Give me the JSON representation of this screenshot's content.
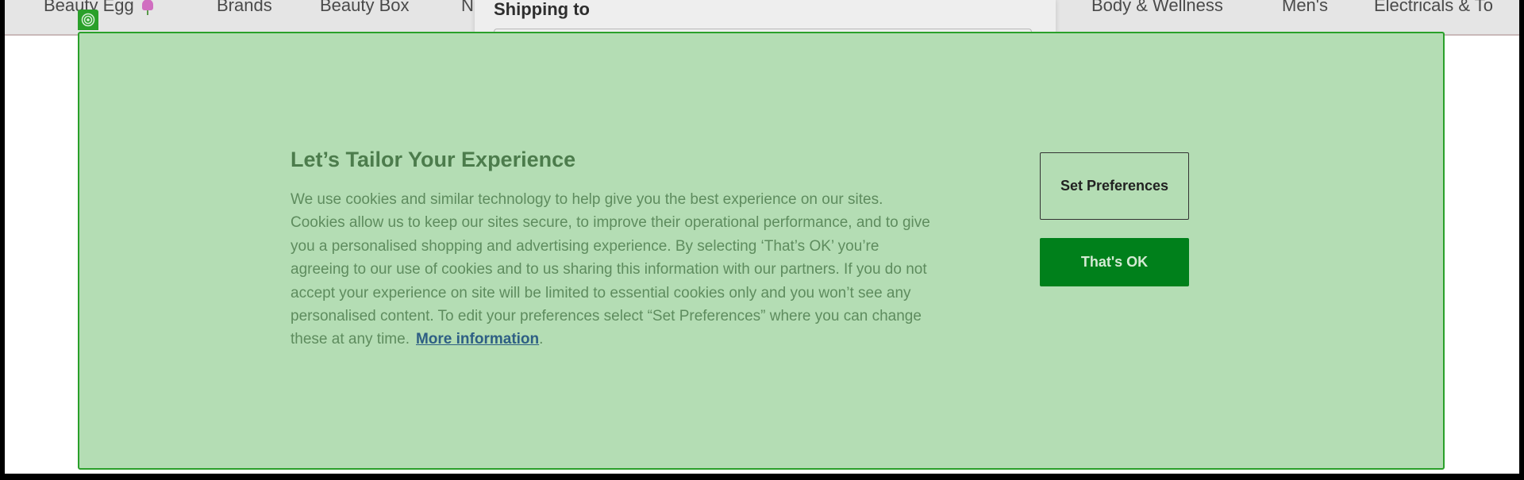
{
  "nav": {
    "items": [
      {
        "label": "Beauty Egg",
        "icon": "egg-flower-icon"
      },
      {
        "label": "Brands"
      },
      {
        "label": "Beauty Box"
      },
      {
        "label": "N"
      },
      {
        "label": "Body & Wellness"
      },
      {
        "label": "Men's"
      },
      {
        "label": "Electricals & To"
      }
    ]
  },
  "shipping": {
    "title": "Shipping to"
  },
  "cookie_banner": {
    "title": "Let’s Tailor Your Experience",
    "body": "We use cookies and similar technology to help give you the best experience on our sites. Cookies allow us to keep our sites secure, to improve their operational performance, and to give you a personalised shopping and advertising experience. By selecting ‘That’s OK’ you’re agreeing to our use of cookies and to us sharing this information with our partners. If you do not accept your experience on site will be limited to essential cookies only and you won’t see any personalised content. To edit your preferences select “Set Preferences” where you can change these at any time.",
    "link_text": "More information",
    "link_suffix": ".",
    "set_preferences_label": "Set Preferences",
    "ok_label": "That's OK"
  },
  "colors": {
    "highlight_fill": "#b4ddb4",
    "highlight_border": "#2aa02a",
    "ok_button": "#00801b",
    "link": "#2e5f84"
  }
}
